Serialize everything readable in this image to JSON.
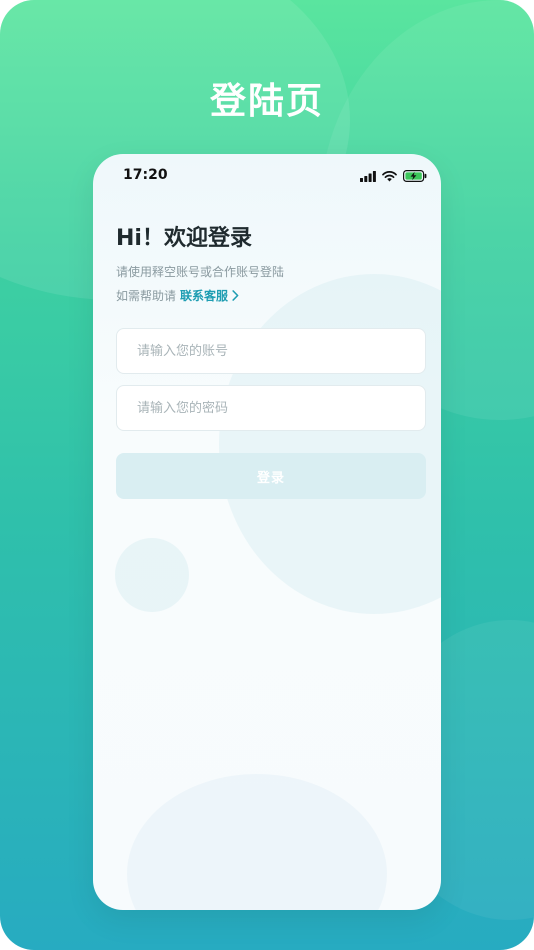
{
  "screen": {
    "headline": "登陆页"
  },
  "status_bar": {
    "time": "17:20"
  },
  "login": {
    "greeting": "Hi！欢迎登录",
    "subtitle": "请使用释空账号或合作账号登陆",
    "help_prefix": "如需帮助请",
    "help_link": "联系客服",
    "account_placeholder": "请输入您的账号",
    "password_placeholder": "请输入您的密码",
    "submit_label": "登录"
  },
  "colors": {
    "accent": "#1e9db2",
    "gradient_top": "#5ae59f",
    "gradient_bottom": "#27abc1",
    "button_disabled": "#d9eef2"
  }
}
